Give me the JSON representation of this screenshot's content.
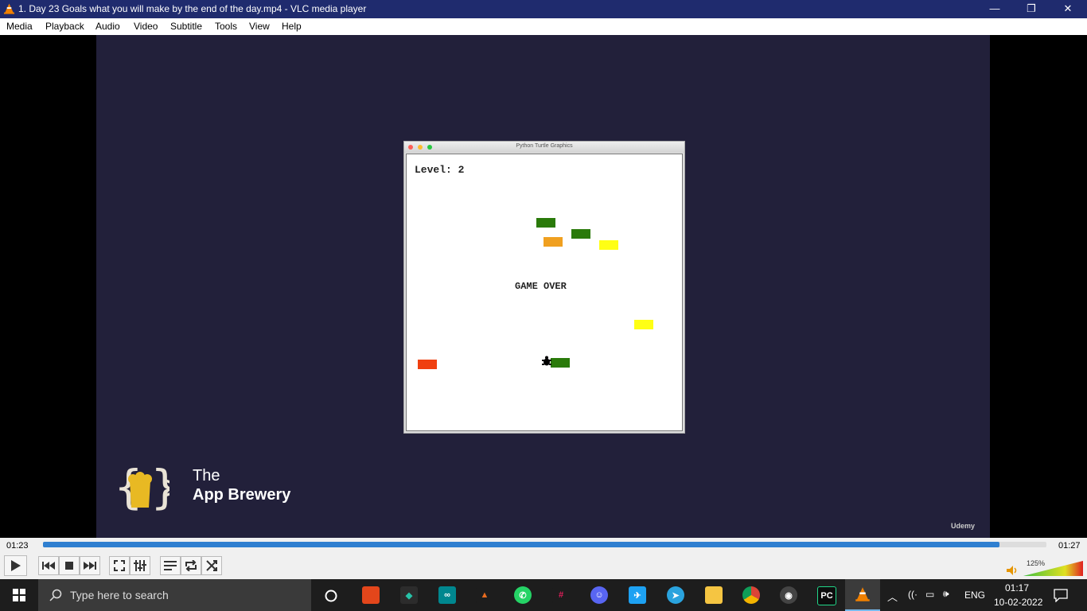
{
  "window": {
    "title": "1. Day 23 Goals what you will make by the end of the day.mp4 - VLC media player",
    "minimize": "—",
    "maximize": "❐",
    "close": "✕"
  },
  "menu": [
    "Media",
    "Playback",
    "Audio",
    "Video",
    "Subtitle",
    "Tools",
    "View",
    "Help"
  ],
  "video": {
    "turtle_window_title": "Python Turtle Graphics",
    "level_text": "Level: 2",
    "game_over_text": "GAME OVER",
    "brand_the": "The",
    "brand_name": "App Brewery",
    "udemy": "Udemy",
    "car_colors": {
      "green": "#2a7a0a",
      "orange": "#f0a020",
      "yellow": "#ffff14",
      "red": "#f04010"
    }
  },
  "player": {
    "elapsed": "01:23",
    "total": "01:27",
    "progress": 0.953,
    "volume": "125%"
  },
  "taskbar": {
    "search_placeholder": "Type here to search",
    "language": "ENG",
    "time": "01:17",
    "date": "10-02-2022"
  }
}
